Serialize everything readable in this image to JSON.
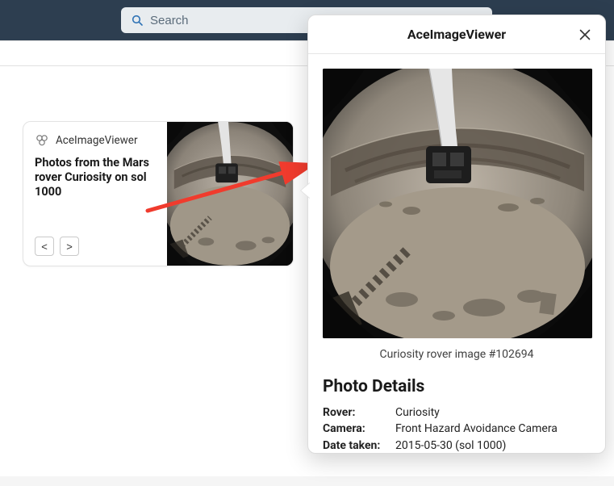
{
  "search": {
    "placeholder": "Search"
  },
  "card": {
    "app_name": "AceImageViewer",
    "title": "Photos from the Mars rover Curiosity on sol 1000",
    "prev_label": "<",
    "next_label": ">"
  },
  "panel": {
    "title": "AceImageViewer",
    "caption": "Curiosity rover image #102694",
    "details_title": "Photo Details",
    "details": {
      "rover": {
        "label": "Rover:",
        "value": "Curiosity"
      },
      "camera": {
        "label": "Camera:",
        "value": "Front Hazard Avoidance Camera"
      },
      "date": {
        "label": "Date taken:",
        "value": "2015-05-30 (sol 1000)"
      }
    }
  }
}
